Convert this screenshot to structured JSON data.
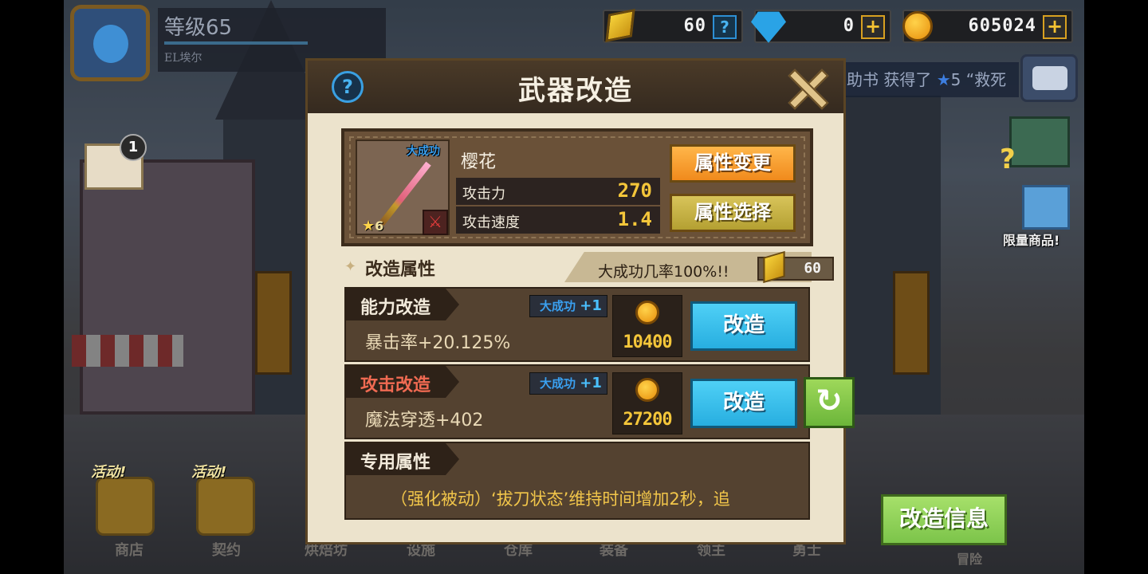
{
  "player": {
    "level": "等级65",
    "name": "EL埃尔"
  },
  "currency": {
    "tickets": "60",
    "gems": "0",
    "coins": "605024",
    "help_symbol": "?",
    "plus_symbol": "+"
  },
  "hud": {
    "marquee_prefix": "助书 获得了",
    "marquee_star": "★",
    "marquee_suffix": "5 “救死",
    "mail_count": "1",
    "limited_goods": "限量商品!",
    "question": "?"
  },
  "bottom_nav": {
    "event_tag": "活动!",
    "items": [
      "商店",
      "契约",
      "烘焙坊",
      "设施",
      "仓库",
      "装备",
      "领主",
      "勇士",
      "冒险"
    ]
  },
  "modal": {
    "title": "武器改造",
    "help_symbol": "?",
    "weapon": {
      "name": "樱花",
      "badge": "大成功",
      "star_level": "6",
      "stats": [
        {
          "label": "攻击力",
          "value": "270"
        },
        {
          "label": "攻击速度",
          "value": "1.4"
        }
      ],
      "btn_change": "属性变更",
      "btn_select": "属性选择"
    },
    "section": {
      "title": "改造属性",
      "chance_text": "大成功几率100%!!",
      "ticket_cost": "60"
    },
    "mods": [
      {
        "tab": "能力改造",
        "great_success": "大成功",
        "great_success_bonus": "+1",
        "desc": "暴击率+20.125%",
        "cost": "10400",
        "button": "改造"
      },
      {
        "tab": "攻击改造",
        "great_success": "大成功",
        "great_success_bonus": "+1",
        "desc": "魔法穿透+402",
        "cost": "27200",
        "button": "改造"
      }
    ],
    "special": {
      "tab": "专用属性",
      "desc": "（强化被动）‘拔刀状态’维持时间增加2秒，追"
    }
  },
  "refresh_symbol": "↻",
  "info_button": "改造信息"
}
